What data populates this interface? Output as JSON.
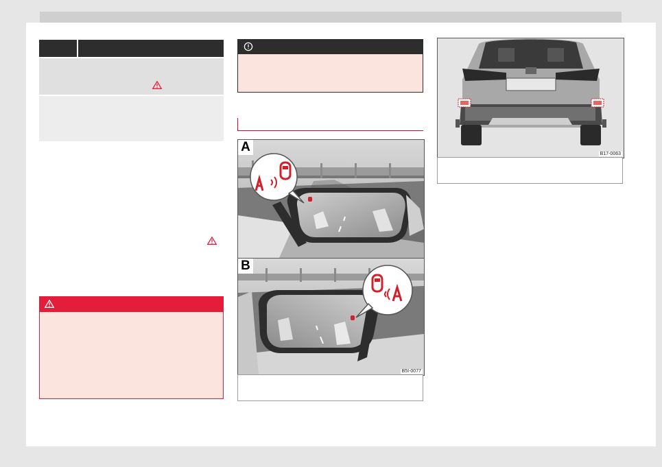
{
  "figures": {
    "mirrors": {
      "label_a": "A",
      "label_b": "B",
      "code": "B5I-0077"
    },
    "rear": {
      "code": "B17-0063"
    }
  },
  "colors": {
    "warning_red": "#e41d3a",
    "note_dark": "#2d2d2d",
    "box_pink": "#fbe4dd",
    "section_red": "#c8102e"
  },
  "icons": [
    "warning-triangle-icon",
    "exclamation-circle-icon",
    "blind-spot-indicator-icon"
  ]
}
